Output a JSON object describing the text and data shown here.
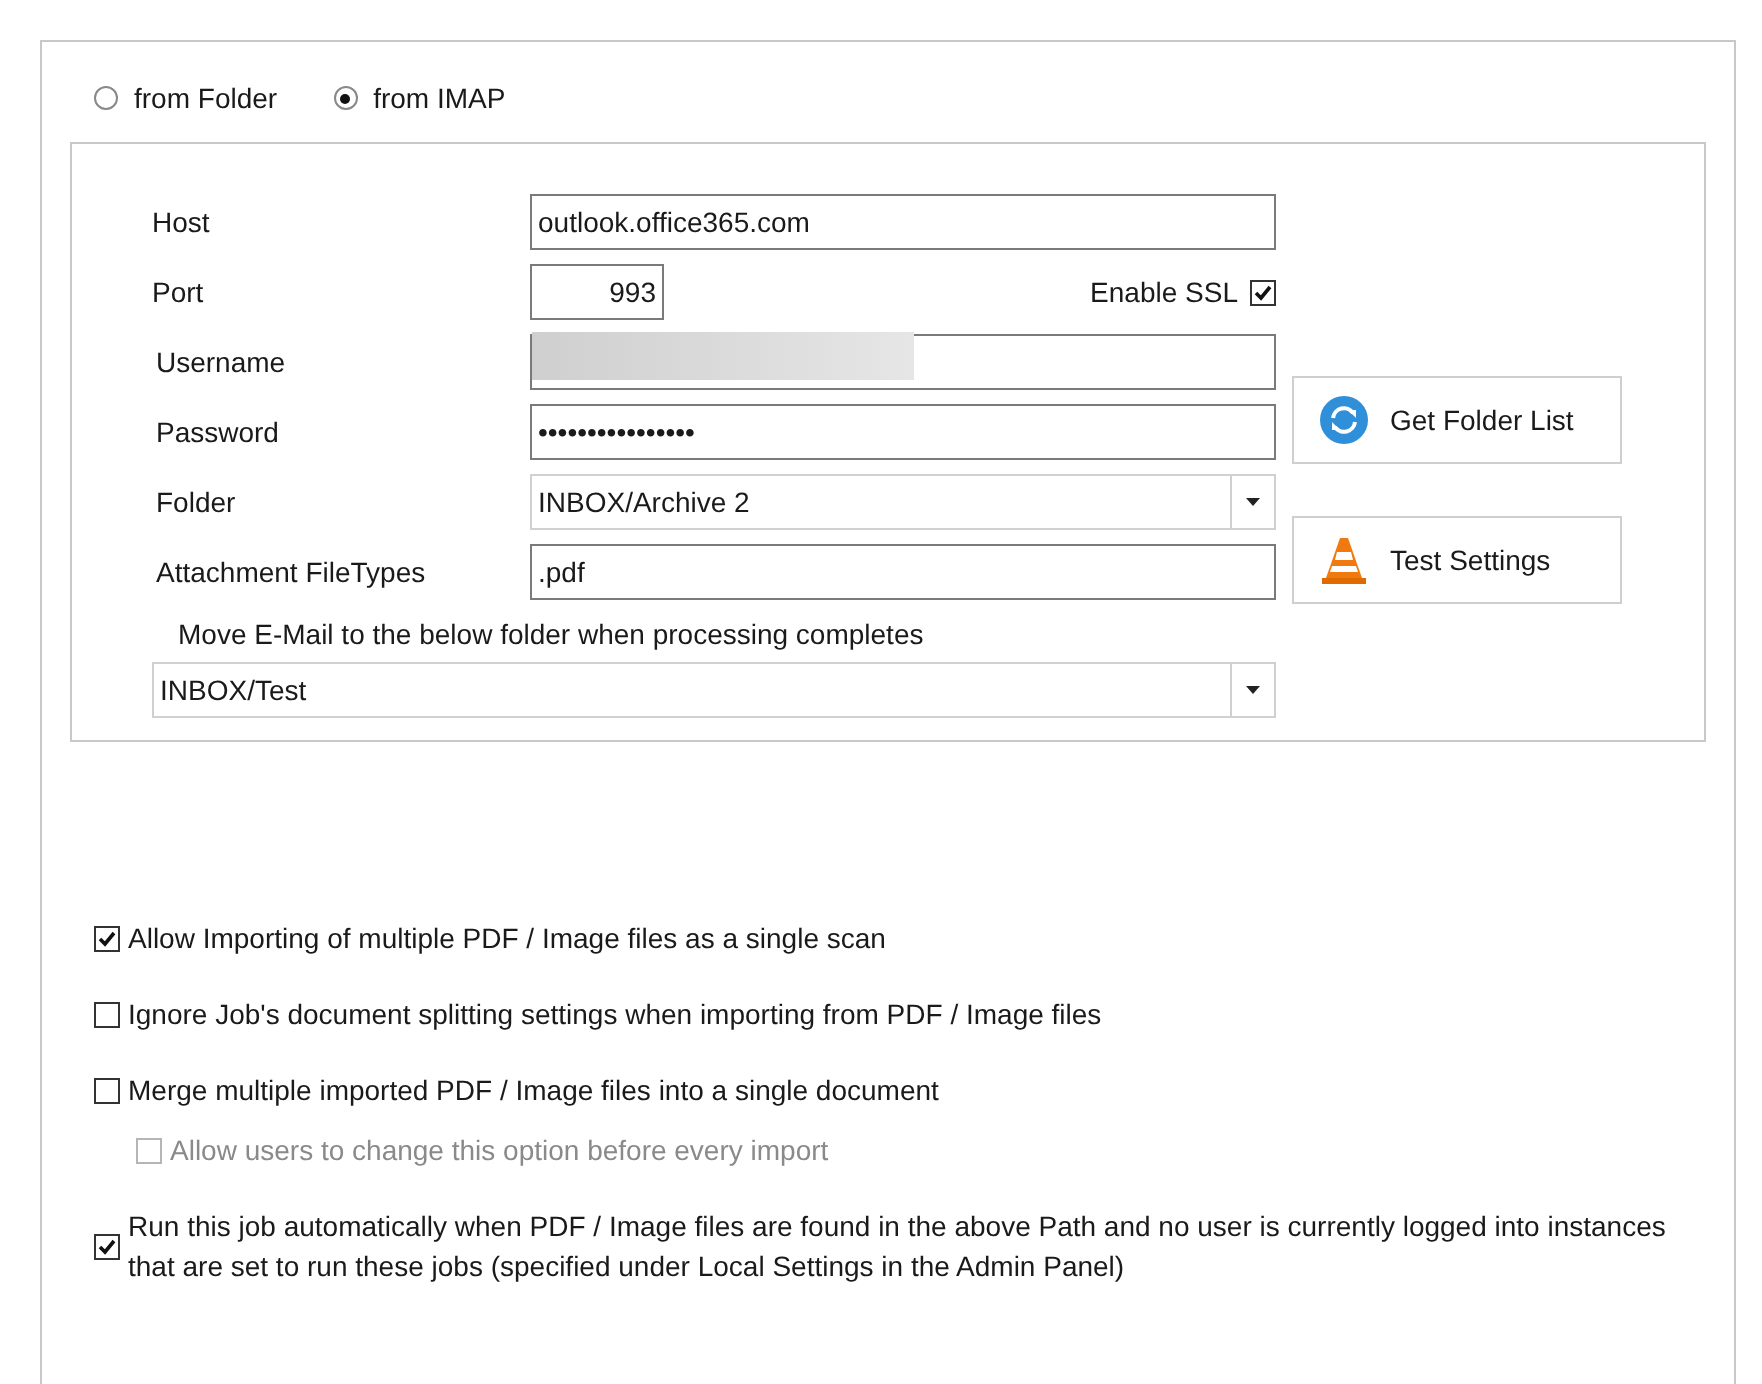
{
  "source_options": [
    {
      "label": "from Folder",
      "selected": false
    },
    {
      "label": "from IMAP",
      "selected": true
    }
  ],
  "imap": {
    "fields": [
      {
        "kind": "text",
        "label": "Host",
        "value": "outlook.office365.com"
      },
      {
        "kind": "port",
        "label": "Port",
        "value": "993"
      },
      {
        "kind": "redacted",
        "label": "Username"
      },
      {
        "kind": "password",
        "label": "Password",
        "value": "••••••••••••••••"
      },
      {
        "kind": "dropdown",
        "label": "Folder",
        "value": "INBOX/Archive 2"
      },
      {
        "kind": "text",
        "label": "Attachment FileTypes",
        "value": ".pdf"
      }
    ],
    "enable_ssl": {
      "label": "Enable SSL",
      "checked": true
    },
    "move_label": "Move E-Mail to the below folder when processing completes",
    "move_folder": "INBOX/Test",
    "buttons": [
      {
        "kind": "refresh",
        "label": "Get Folder List"
      },
      {
        "kind": "cone",
        "label": "Test Settings"
      }
    ]
  },
  "options": [
    {
      "label": "Allow Importing of multiple PDF / Image files as a single scan",
      "checked": true,
      "disabled": false
    },
    {
      "label": "Ignore Job's document splitting settings when importing from PDF / Image files",
      "checked": false,
      "disabled": false
    },
    {
      "label": "Merge multiple imported PDF / Image files into a single document",
      "checked": false,
      "disabled": false,
      "children": [
        {
          "label": "Allow users to change this option before every import",
          "checked": false,
          "disabled": true
        }
      ]
    },
    {
      "label": "Run this job automatically when PDF / Image files are found in the above Path and no user is currently logged into instances that are set to run these jobs (specified under Local Settings in the Admin Panel)",
      "checked": true,
      "disabled": false
    }
  ]
}
